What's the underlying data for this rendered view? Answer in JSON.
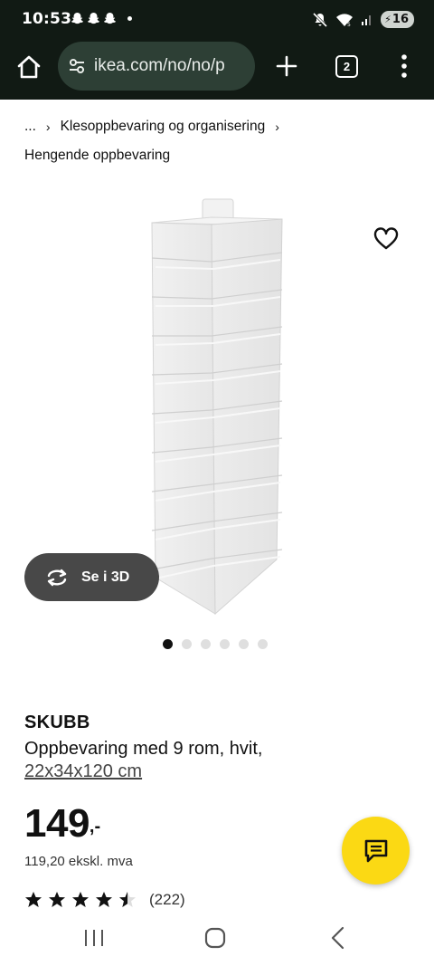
{
  "status_bar": {
    "time": "10:53",
    "battery": "16"
  },
  "browser": {
    "url": "ikea.com/no/no/p",
    "tab_count": "2"
  },
  "breadcrumb": {
    "ellipsis": "...",
    "items": [
      "Klesoppbevaring og organisering",
      "Hengende oppbevaring"
    ]
  },
  "gallery": {
    "see_3d_label": "Se i 3D",
    "dot_count": 6,
    "active_dot": 0
  },
  "product": {
    "brand": "SKUBB",
    "description": "Oppbevaring med 9 rom, hvit,",
    "dimensions": "22x34x120 cm",
    "price_integer": "149",
    "price_suffix": ",-",
    "price_ex_vat": "119,20 ekskl. mva",
    "rating_stars": 4.5,
    "review_count": "(222)"
  },
  "colors": {
    "chrome_bg": "#111a14",
    "url_pill_bg": "#2d3f35",
    "chat_button": "#fbd914",
    "see_3d_bg": "#484848"
  },
  "icons": [
    "snapchat-icon",
    "mute-icon",
    "wifi-icon",
    "signal-icon",
    "home-icon",
    "site-settings-icon",
    "new-tab-icon",
    "tab-switcher-icon",
    "menu-icon",
    "heart-icon",
    "rotate-3d-icon",
    "star-icon",
    "chat-icon",
    "recents-icon",
    "nav-home-icon",
    "back-icon"
  ]
}
